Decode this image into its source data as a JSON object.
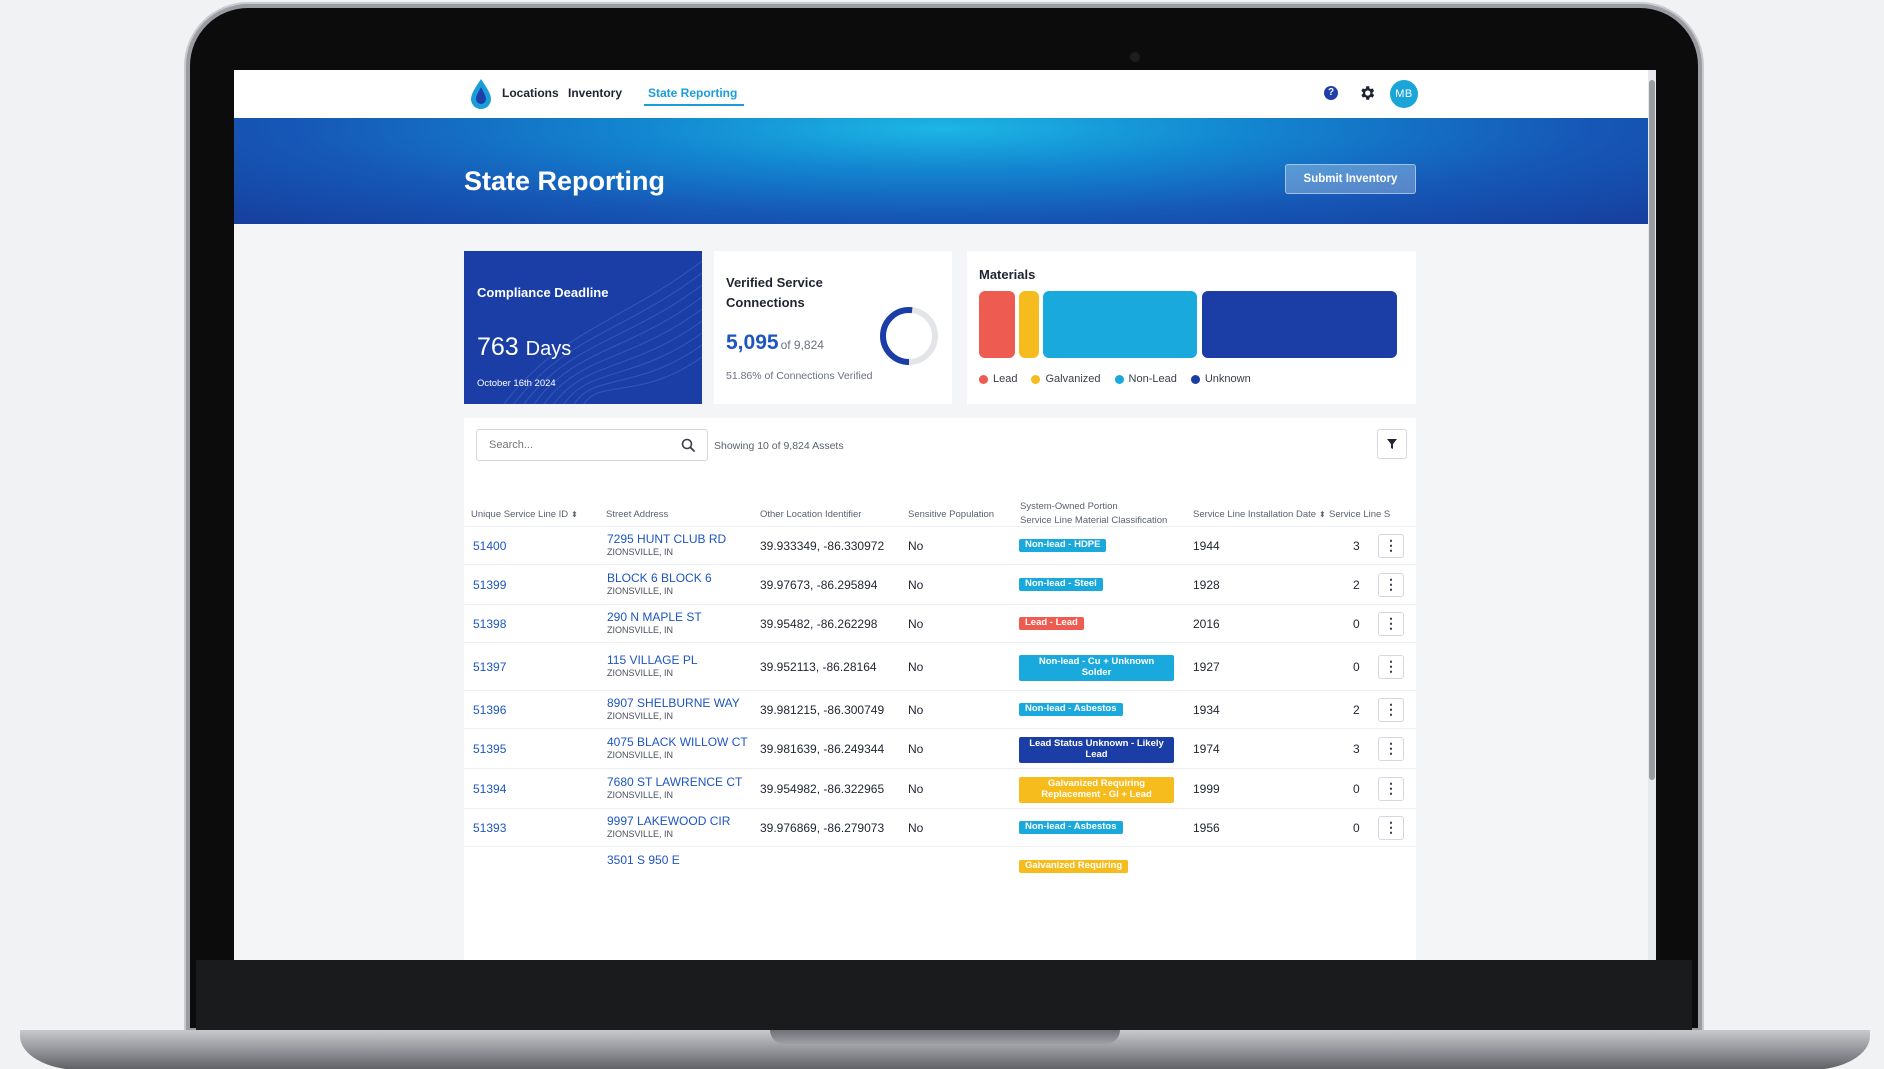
{
  "nav": {
    "items": [
      "Locations",
      "Inventory",
      "State Reporting"
    ],
    "active": "State Reporting",
    "help_symbol": "?",
    "avatar_initials": "MB"
  },
  "banner": {
    "title": "State Reporting",
    "submit_label": "Submit Inventory"
  },
  "compliance": {
    "label": "Compliance Deadline",
    "days_value": "763",
    "days_unit": "Days",
    "date": "October 16th 2024"
  },
  "verified": {
    "title": "Verified Service Connections",
    "count": "5,095",
    "of_total": "of 9,824",
    "percent_text": "51.86% of Connections Verified",
    "fraction": 0.5186
  },
  "materials": {
    "title": "Materials",
    "legend": [
      {
        "label": "Lead",
        "color": "#ee5b50"
      },
      {
        "label": "Galvanized",
        "color": "#f6bb1c"
      },
      {
        "label": "Non-Lead",
        "color": "#19a9dd"
      },
      {
        "label": "Unknown",
        "color": "#1a3ea6"
      }
    ]
  },
  "table": {
    "search_placeholder": "Search...",
    "showing_text": "Showing 10 of 9,824 Assets",
    "headers": {
      "id": "Unique Service Line ID",
      "address": "Street Address",
      "other_id": "Other Location Identifier",
      "sensitive": "Sensitive Population",
      "classification_line1": "System-Owned Portion",
      "classification_line2": "Service Line Material Classification",
      "install_date": "Service Line Installation Date",
      "service_line": "Service Line S"
    },
    "rows": [
      {
        "id": "51400",
        "address": "7295 HUNT CLUB RD",
        "city": "ZIONSVILLE, IN",
        "coords": "39.933349, -86.330972",
        "sensitive": "No",
        "badge": "Non-lead - HDPE",
        "badge_color": "#19a9dd",
        "year": "1944",
        "count": "3"
      },
      {
        "id": "51399",
        "address": "BLOCK 6 BLOCK 6",
        "city": "ZIONSVILLE, IN",
        "coords": "39.97673, -86.295894",
        "sensitive": "No",
        "badge": "Non-lead - Steel",
        "badge_color": "#19a9dd",
        "year": "1928",
        "count": "2"
      },
      {
        "id": "51398",
        "address": "290 N MAPLE ST",
        "city": "ZIONSVILLE, IN",
        "coords": "39.95482, -86.262298",
        "sensitive": "No",
        "badge": "Lead - Lead",
        "badge_color": "#ee5b50",
        "year": "2016",
        "count": "0"
      },
      {
        "id": "51397",
        "address": "115 VILLAGE PL",
        "city": "ZIONSVILLE, IN",
        "coords": "39.952113, -86.28164",
        "sensitive": "No",
        "badge": "Non-lead - Cu + Unknown Solder",
        "badge_color": "#19a9dd",
        "year": "1927",
        "count": "0"
      },
      {
        "id": "51396",
        "address": "8907 SHELBURNE WAY",
        "city": "ZIONSVILLE, IN",
        "coords": "39.981215, -86.300749",
        "sensitive": "No",
        "badge": "Non-lead - Asbestos",
        "badge_color": "#19a9dd",
        "year": "1934",
        "count": "2"
      },
      {
        "id": "51395",
        "address": "4075 BLACK WILLOW CT",
        "city": "ZIONSVILLE, IN",
        "coords": "39.981639, -86.249344",
        "sensitive": "No",
        "badge": "Lead Status Unknown - Likely Lead",
        "badge_color": "#1a3ea6",
        "year": "1974",
        "count": "3"
      },
      {
        "id": "51394",
        "address": "7680 ST LAWRENCE CT",
        "city": "ZIONSVILLE, IN",
        "coords": "39.954982, -86.322965",
        "sensitive": "No",
        "badge": "Galvanized Requiring Replacement - GI + Lead",
        "badge_color": "#f6bb1c",
        "year": "1999",
        "count": "0"
      },
      {
        "id": "51393",
        "address": "9997 LAKEWOOD CIR",
        "city": "ZIONSVILLE, IN",
        "coords": "39.976869, -86.279073",
        "sensitive": "No",
        "badge": "Non-lead - Asbestos",
        "badge_color": "#19a9dd",
        "year": "1956",
        "count": "0"
      },
      {
        "id": "",
        "address": "3501 S 950 E",
        "city": "",
        "coords": "",
        "sensitive": "",
        "badge": "Galvanized Requiring",
        "badge_color": "#f6bb1c",
        "year": "",
        "count": ""
      }
    ]
  }
}
